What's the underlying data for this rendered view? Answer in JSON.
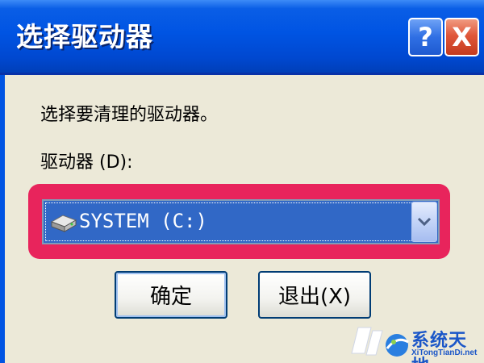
{
  "window": {
    "title": "选择驱动器",
    "help_icon": "help-icon",
    "close_icon": "close-icon",
    "help_glyph": "?",
    "close_glyph": "X"
  },
  "content": {
    "instruction": "选择要清理的驱动器。",
    "drive_label": "驱动器 (D):",
    "selected_drive": "SYSTEM (C:)",
    "drive_icon": "hard-drive-icon",
    "dropdown_icon": "chevron-down-icon"
  },
  "buttons": {
    "ok_label": "确定",
    "exit_label": "退出(X)"
  },
  "watermark": {
    "title": "系统天地",
    "subtitle": "XiTongTianDi.net"
  },
  "colors": {
    "titlebar": "#0054e3",
    "highlight": "#e8245c",
    "selection": "#3168c6",
    "dialog_bg": "#ece9d8"
  }
}
